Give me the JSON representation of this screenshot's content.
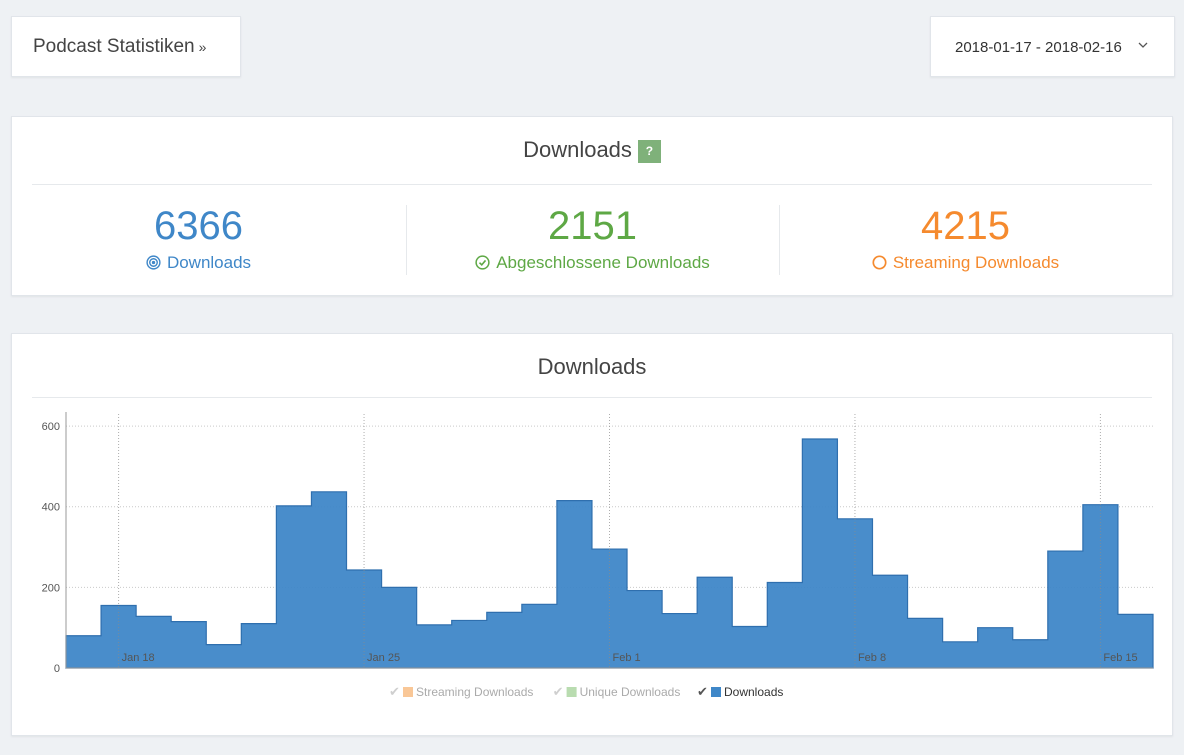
{
  "header": {
    "title": "Podcast Statistiken",
    "title_suffix": "»",
    "date_range": "2018-01-17 - 2018-02-16"
  },
  "stats": {
    "heading": "Downloads",
    "help_label": "?",
    "items": [
      {
        "value": "6366",
        "label": "Downloads",
        "color": "#3f87c8",
        "icon": "target-icon"
      },
      {
        "value": "2151",
        "label": "Abgeschlossene Downloads",
        "color": "#5ea845",
        "icon": "check-circle-icon"
      },
      {
        "value": "4215",
        "label": "Streaming Downloads",
        "color": "#f58a2e",
        "icon": "circle-icon"
      }
    ]
  },
  "chart": {
    "heading": "Downloads"
  },
  "chart_data": {
    "type": "area",
    "style": "step",
    "x_start": "2018-01-17",
    "ylim": [
      0,
      620
    ],
    "yticks": [
      0,
      200,
      400,
      600
    ],
    "x_tick_labels": [
      {
        "date": "2018-01-18",
        "label": "Jan 18"
      },
      {
        "date": "2018-01-25",
        "label": "Jan 25"
      },
      {
        "date": "2018-02-01",
        "label": "Feb 1"
      },
      {
        "date": "2018-02-08",
        "label": "Feb 8"
      },
      {
        "date": "2018-02-15",
        "label": "Feb 15"
      }
    ],
    "grid": true,
    "legend_position": "bottom",
    "series": [
      {
        "name": "Streaming Downloads",
        "color": "#f9c797",
        "visible": false,
        "values": []
      },
      {
        "name": "Unique Downloads",
        "color": "#b9dcb0",
        "visible": false,
        "values": []
      },
      {
        "name": "Downloads",
        "color": "#3f87c8",
        "visible": true,
        "values": [
          80,
          155,
          128,
          115,
          58,
          110,
          402,
          437,
          243,
          200,
          107,
          118,
          138,
          158,
          415,
          295,
          192,
          135,
          225,
          103,
          212,
          568,
          370,
          230,
          123,
          65,
          100,
          70,
          290,
          405,
          133
        ]
      }
    ]
  }
}
